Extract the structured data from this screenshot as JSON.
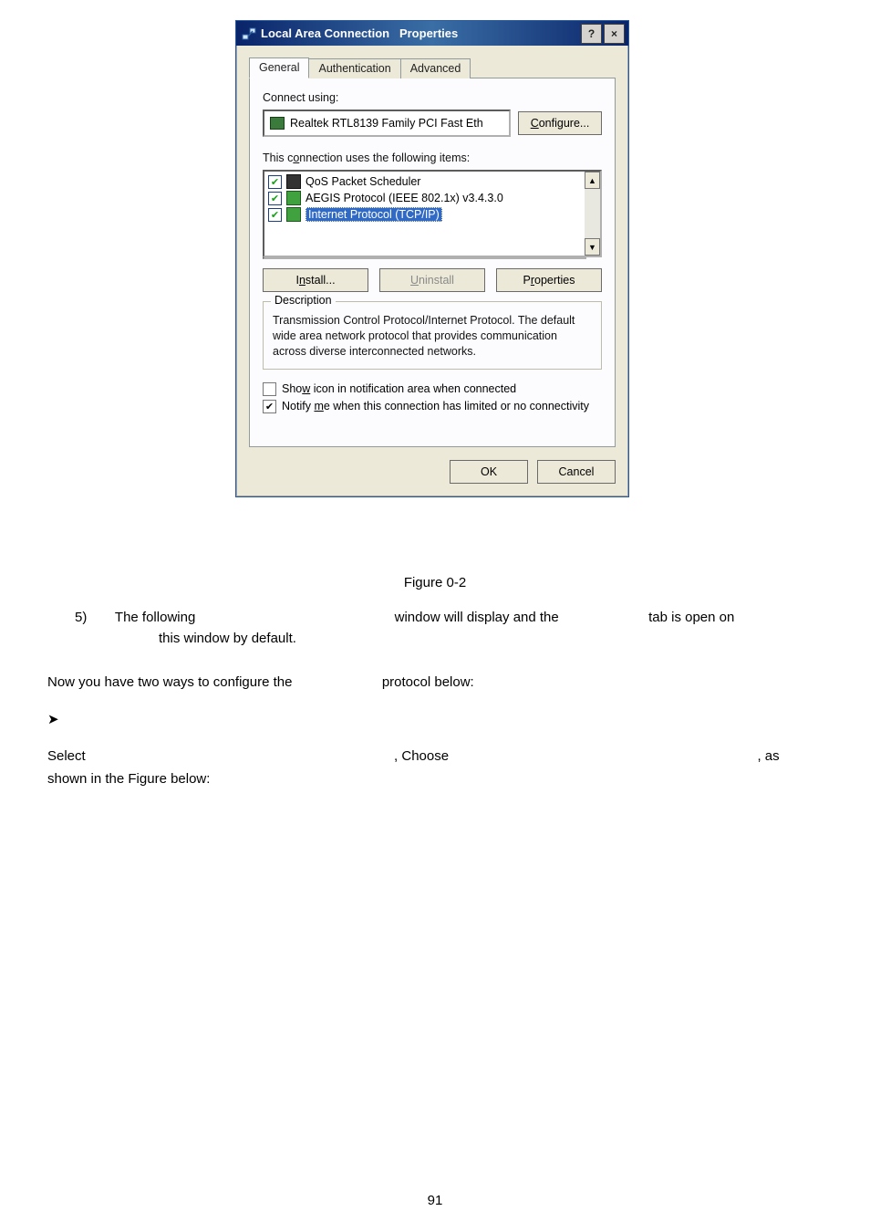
{
  "dialog": {
    "title_prefix": "Local Area Connection",
    "title_suffix": "Properties",
    "help_btn": "?",
    "close_btn": "×",
    "tabs": {
      "general": "General",
      "auth": "Authentication",
      "advanced": "Advanced"
    },
    "connect_using_label": "Connect using:",
    "adapter_name": "Realtek RTL8139 Family PCI Fast Eth",
    "configure_btn": "Configure...",
    "configure_accel": "C",
    "items_label": "This connection uses the following items:",
    "items_accel": "o",
    "list": {
      "qos": "QoS Packet Scheduler",
      "aegis": "AEGIS Protocol (IEEE 802.1x) v3.4.3.0",
      "tcpip": "Internet Protocol (TCP/IP)"
    },
    "install_btn": "Install...",
    "install_accel": "n",
    "uninstall_btn": "Uninstall",
    "uninstall_accel": "U",
    "properties_btn": "Properties",
    "properties_accel": "r",
    "group_title": "Description",
    "description": "Transmission Control Protocol/Internet Protocol. The default wide area network protocol that provides communication across diverse interconnected networks.",
    "show_icon": "Show icon in notification area when connected",
    "show_accel": "w",
    "notify": "Notify me when this connection has limited or no connectivity",
    "notify_accel": "m",
    "ok": "OK",
    "cancel": "Cancel"
  },
  "doc": {
    "figure_caption": "Figure 0-2",
    "step_num": "5)",
    "step_a": "The following",
    "step_b": "window will display and the",
    "step_c": "tab is open on",
    "step_line2": "this window by default.",
    "configure_line_a": "Now you have two ways to configure the",
    "configure_line_b": "protocol below:",
    "arrow": "❹",
    "select_a": "Select",
    "select_b": ",  Choose",
    "select_c": ",  as",
    "select_line2": "shown in the Figure below:",
    "page": "91"
  }
}
